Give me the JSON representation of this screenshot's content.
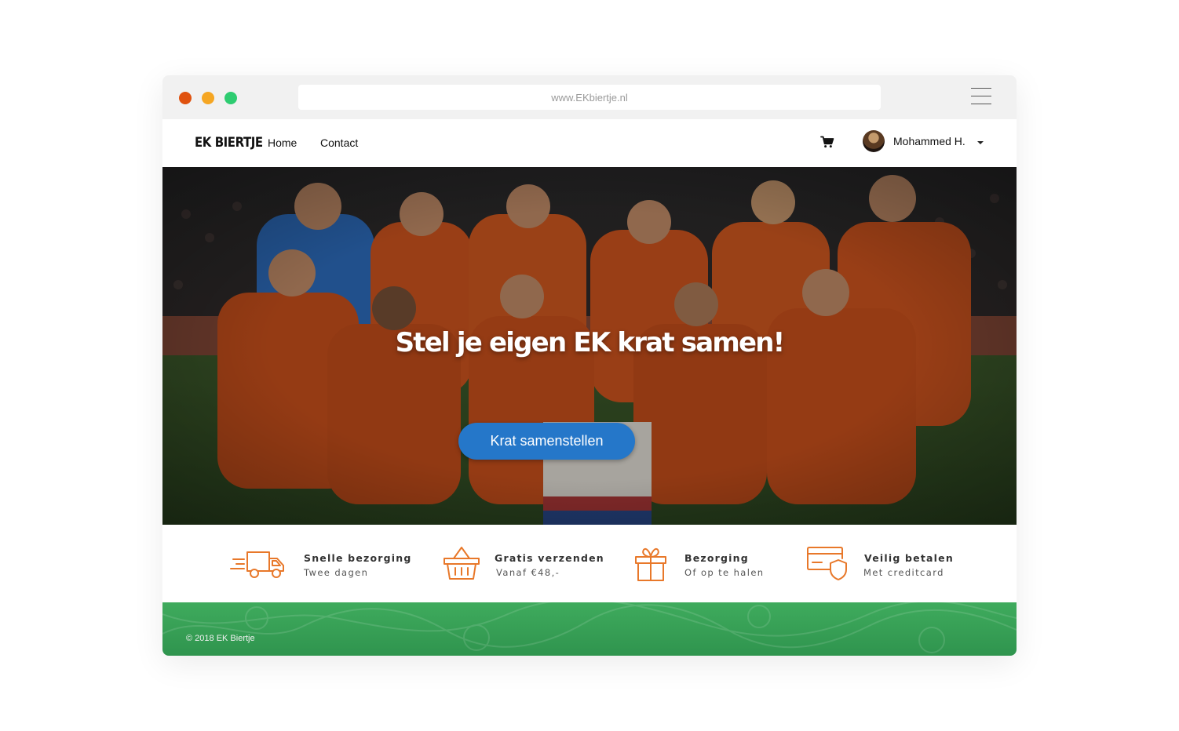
{
  "browser": {
    "url": "www.EKbiertje.nl",
    "traffic_lights": [
      "#e0520f",
      "#f5a623",
      "#2ecc71"
    ]
  },
  "nav": {
    "logo": "EK BIERTJE",
    "links": [
      {
        "label": "Home"
      },
      {
        "label": "Contact"
      }
    ],
    "cart_icon": "shopping-cart-icon",
    "user": {
      "name": "Mohammed H.",
      "avatar_icon": "avatar",
      "dropdown_icon": "caret-down-icon"
    }
  },
  "hero": {
    "title": "Stel je eigen EK krat samen!",
    "button_label": "Krat samenstellen",
    "button_color": "#2577c9",
    "image": "dutch-national-football-team-photo"
  },
  "features": [
    {
      "icon": "delivery-truck-icon",
      "title": "Snelle bezorging",
      "subtitle": "Twee dagen"
    },
    {
      "icon": "basket-icon",
      "title": "Gratis verzenden",
      "subtitle": "Vanaf €48,-"
    },
    {
      "icon": "gift-icon",
      "title": "Bezorging",
      "subtitle": "Of op te halen"
    },
    {
      "icon": "credit-card-shield-icon",
      "title": "Veilig betalen",
      "subtitle": "Met creditcard"
    }
  ],
  "accent_color": "#e8782a",
  "footer": {
    "copyright": "© 2018 EK Biertje",
    "color": "#3fab5d"
  }
}
